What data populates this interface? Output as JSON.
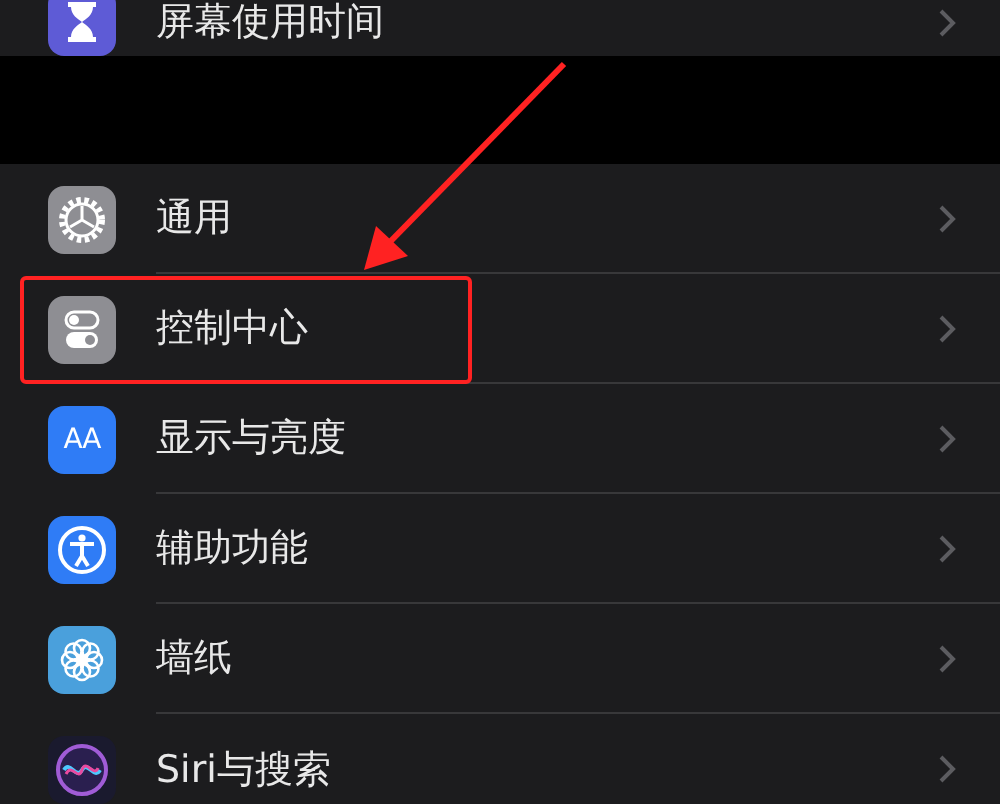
{
  "groups": [
    {
      "items": [
        {
          "label": "屏幕使用时间",
          "kind": "hourglass",
          "highlighted": false
        }
      ]
    },
    {
      "items": [
        {
          "label": "通用",
          "kind": "gear",
          "highlighted": false
        },
        {
          "label": "控制中心",
          "kind": "toggles",
          "highlighted": true
        },
        {
          "label": "显示与亮度",
          "kind": "text",
          "icon_text": "AA",
          "highlighted": false
        },
        {
          "label": "辅助功能",
          "kind": "accessibility",
          "highlighted": false
        },
        {
          "label": "墙纸",
          "kind": "flower",
          "highlighted": false
        },
        {
          "label": "Siri与搜索",
          "kind": "siri",
          "highlighted": false
        }
      ]
    }
  ]
}
